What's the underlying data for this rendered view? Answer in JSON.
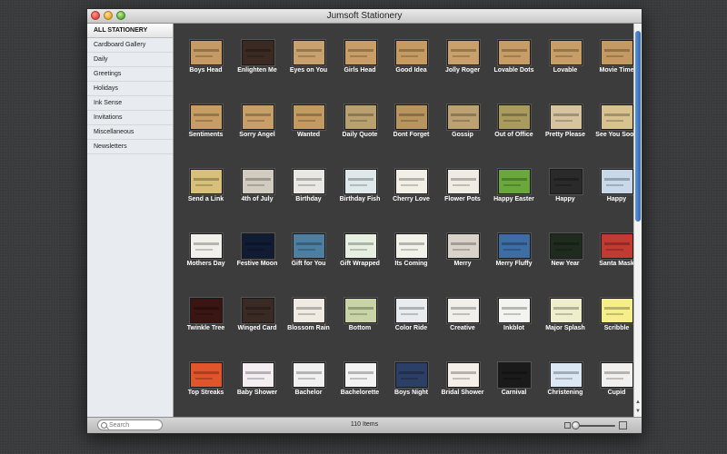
{
  "window": {
    "title": "Jumsoft Stationery"
  },
  "sidebar": {
    "items": [
      {
        "label": "ALL STATIONERY",
        "active": true
      },
      {
        "label": "Cardboard Gallery"
      },
      {
        "label": "Daily"
      },
      {
        "label": "Greetings"
      },
      {
        "label": "Holidays"
      },
      {
        "label": "Ink Sense"
      },
      {
        "label": "Invitations"
      },
      {
        "label": "Miscellaneous"
      },
      {
        "label": "Newsletters"
      }
    ]
  },
  "templates": [
    {
      "label": "Boys Head",
      "color": "#c59a63"
    },
    {
      "label": "Enlighten Me",
      "color": "#3b2a22"
    },
    {
      "label": "Eyes on You",
      "color": "#c9a16c"
    },
    {
      "label": "Girls Head",
      "color": "#c89d66"
    },
    {
      "label": "Good Idea",
      "color": "#c59b62"
    },
    {
      "label": "Jolly Roger",
      "color": "#c9a06a"
    },
    {
      "label": "Lovable Dots",
      "color": "#c79c65"
    },
    {
      "label": "Lovable",
      "color": "#c89e67"
    },
    {
      "label": "Movie Time",
      "color": "#c49962"
    },
    {
      "label": "Sentiments",
      "color": "#c79d66"
    },
    {
      "label": "Sorry Angel",
      "color": "#c89f68"
    },
    {
      "label": "Wanted",
      "color": "#c49a63"
    },
    {
      "label": "Daily Quote",
      "color": "#b9a070"
    },
    {
      "label": "Dont Forget",
      "color": "#b8955f"
    },
    {
      "label": "Gossip",
      "color": "#bca173"
    },
    {
      "label": "Out of Office",
      "color": "#a99a5e"
    },
    {
      "label": "Pretty Please",
      "color": "#d6c3a0"
    },
    {
      "label": "See You Soon",
      "color": "#d8c28f"
    },
    {
      "label": "Send a Link",
      "color": "#d8c07a"
    },
    {
      "label": "4th of July",
      "color": "#d2ccc0"
    },
    {
      "label": "Birthday",
      "color": "#e9e8e4"
    },
    {
      "label": "Birthday Fish",
      "color": "#dfe9ec"
    },
    {
      "label": "Cherry Love",
      "color": "#f1efe6"
    },
    {
      "label": "Flower Pots",
      "color": "#f0ece4"
    },
    {
      "label": "Happy Easter",
      "color": "#6aa83c"
    },
    {
      "label": "Happy",
      "color": "#2a2a2a"
    },
    {
      "label": "Happy",
      "color": "#c9d9ea"
    },
    {
      "label": "Mothers Day",
      "color": "#f2f0ea"
    },
    {
      "label": "Festive Moon",
      "color": "#0f1c34"
    },
    {
      "label": "Gift for You",
      "color": "#4d7fa3"
    },
    {
      "label": "Gift Wrapped",
      "color": "#e6efe0"
    },
    {
      "label": "Its Coming",
      "color": "#f2f1ea"
    },
    {
      "label": "Merry",
      "color": "#d8d2c8"
    },
    {
      "label": "Merry Fluffy",
      "color": "#3e6da6"
    },
    {
      "label": "New Year",
      "color": "#1f2b1e"
    },
    {
      "label": "Santa Mask",
      "color": "#c13b33"
    },
    {
      "label": "Twinkle Tree",
      "color": "#3a1512"
    },
    {
      "label": "Winged Card",
      "color": "#3a2a24"
    },
    {
      "label": "Blossom Rain",
      "color": "#efeae2"
    },
    {
      "label": "Bottom",
      "color": "#c9d4a6"
    },
    {
      "label": "Color Ride",
      "color": "#e9ecef"
    },
    {
      "label": "Creative",
      "color": "#f1efe9"
    },
    {
      "label": "Inkblot",
      "color": "#f3f3f0"
    },
    {
      "label": "Major Splash",
      "color": "#eeeecc"
    },
    {
      "label": "Scribble",
      "color": "#f6ee8a"
    },
    {
      "label": "Top Streaks",
      "color": "#e0562c"
    },
    {
      "label": "Baby Shower",
      "color": "#f4eef2"
    },
    {
      "label": "Bachelor",
      "color": "#f1f1f1"
    },
    {
      "label": "Bachelorette",
      "color": "#f3f3f3"
    },
    {
      "label": "Boys Night",
      "color": "#2c3f66"
    },
    {
      "label": "Bridal Shower",
      "color": "#f4efe8"
    },
    {
      "label": "Carnival",
      "color": "#1a1a1a"
    },
    {
      "label": "Christening",
      "color": "#dbe7f2"
    },
    {
      "label": "Cupid",
      "color": "#f2f0ee"
    }
  ],
  "status": {
    "count_text": "110 Items",
    "search_placeholder": "Search"
  },
  "zoom_level": 0.05
}
